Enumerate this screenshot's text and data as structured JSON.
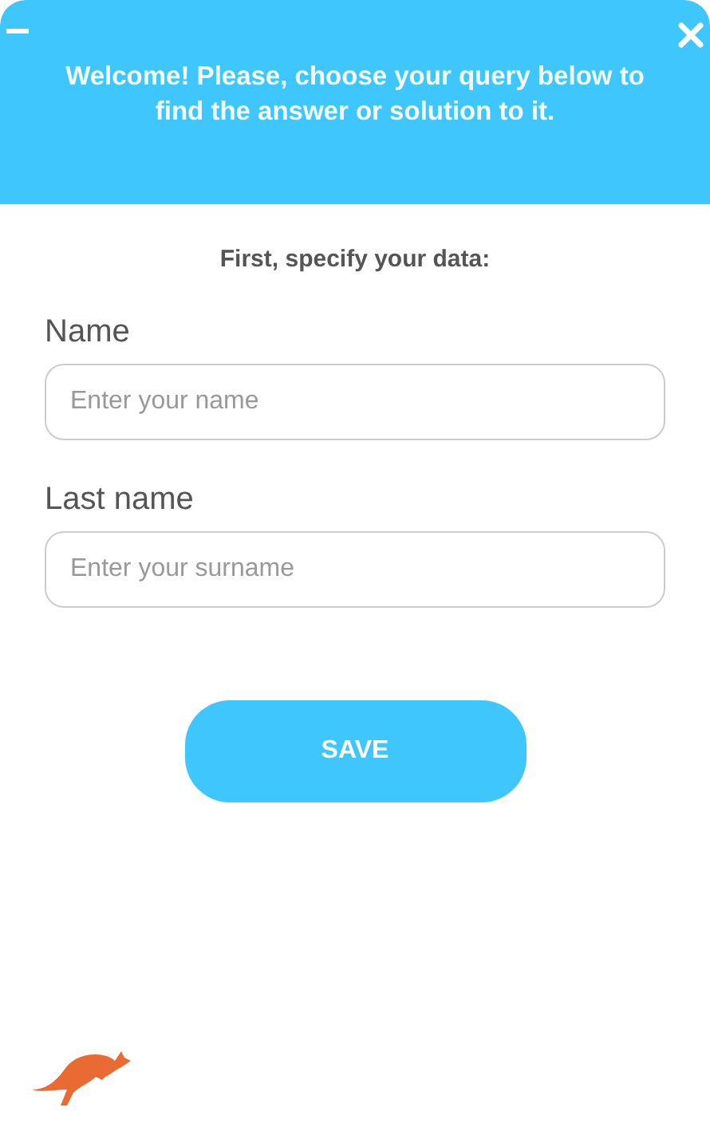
{
  "header": {
    "message": "Welcome! Please, choose your query below to find the answer or solution to it."
  },
  "form": {
    "intro": "First, specify your data:",
    "fields": [
      {
        "label": "Name",
        "placeholder": "Enter your name"
      },
      {
        "label": "Last name",
        "placeholder": "Enter your surname"
      }
    ],
    "save_button": "SAVE"
  }
}
